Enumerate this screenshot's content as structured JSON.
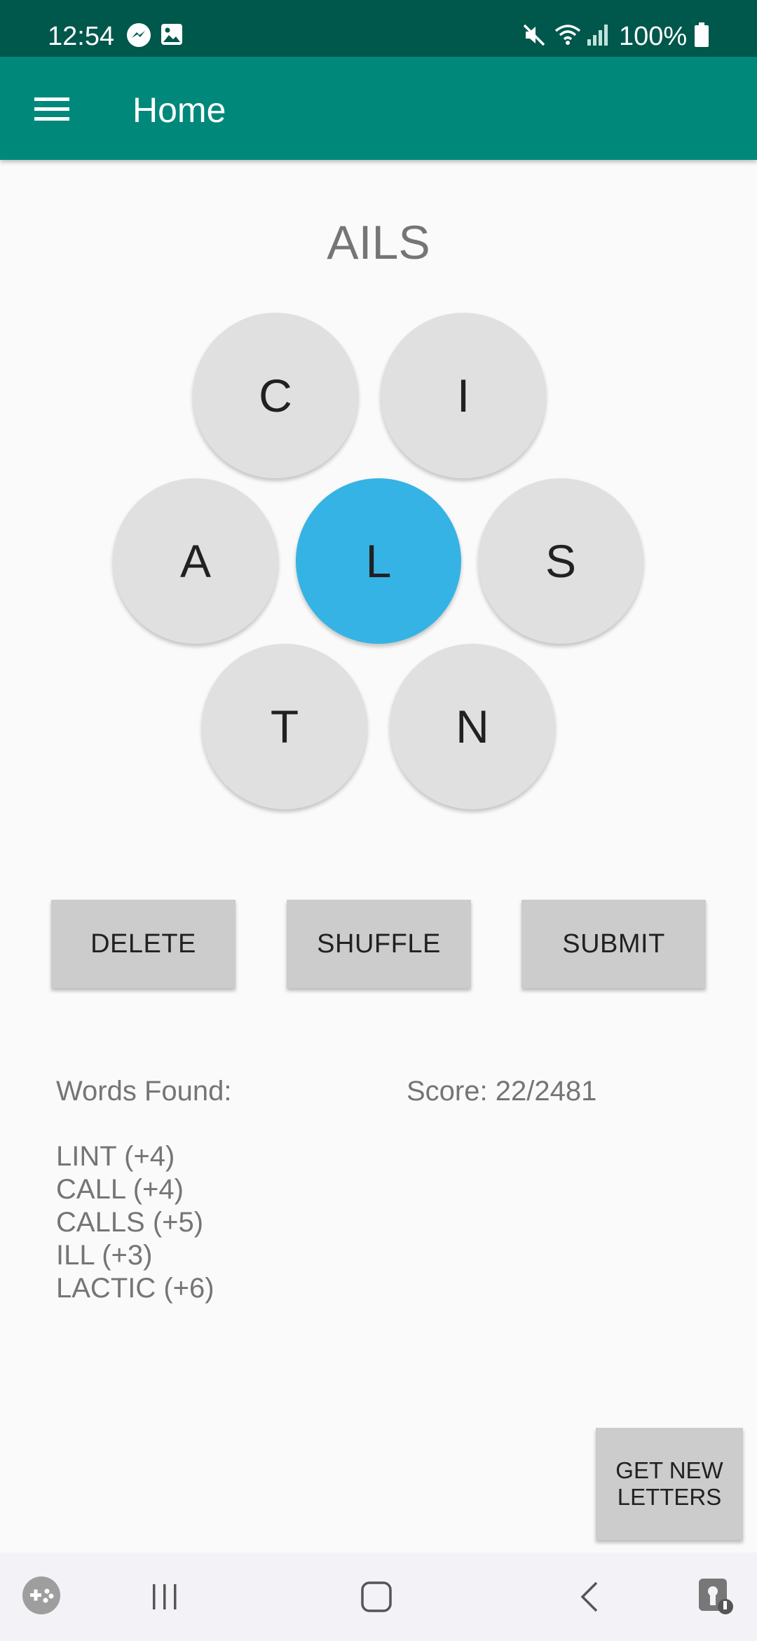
{
  "status_bar": {
    "time": "12:54",
    "battery": "100%",
    "icons": [
      "messenger-icon",
      "gallery-icon",
      "mute-icon",
      "wifi-icon",
      "signal-icon",
      "battery-icon"
    ]
  },
  "app_bar": {
    "title": "Home",
    "menu_icon": "hamburger-menu-icon"
  },
  "game": {
    "current_word": "AILS",
    "letters": {
      "top_left": "C",
      "top_right": "I",
      "left": "A",
      "center": "L",
      "right": "S",
      "bottom_left": "T",
      "bottom_right": "N"
    },
    "center_color": "#35b3e4"
  },
  "actions": {
    "delete": "DELETE",
    "shuffle": "SHUFFLE",
    "submit": "SUBMIT"
  },
  "results": {
    "words_found_label": "Words Found:",
    "score": "Score: 22/2481",
    "words": [
      "LINT (+4)",
      "CALL (+4)",
      "CALLS (+5)",
      "ILL (+3)",
      "LACTIC (+6)"
    ]
  },
  "new_letters_button": "GET NEW\nLETTERS",
  "nav_bar": {
    "icons": [
      "game-launcher-icon",
      "recent-apps-icon",
      "home-icon",
      "back-icon",
      "screen-pin-icon"
    ]
  },
  "colors": {
    "status_bar": "#00574b",
    "app_bar": "#00897b",
    "letter_tile": "#e0e0e0",
    "button": "#cccccc"
  }
}
